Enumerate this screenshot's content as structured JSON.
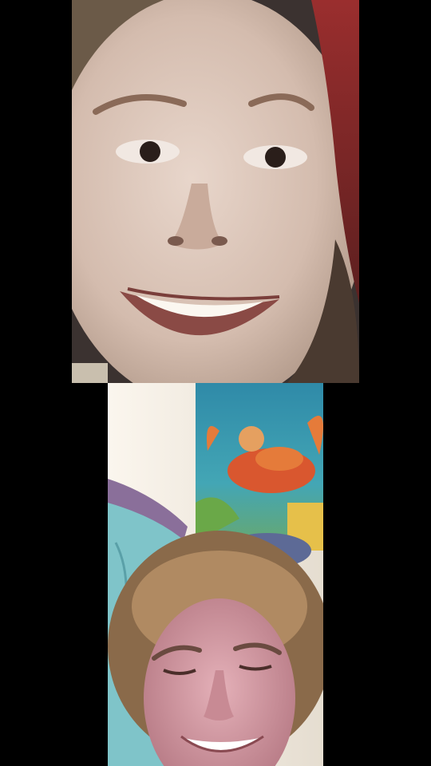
{
  "call": {
    "participants": [
      {
        "role": "remote-participant-video"
      },
      {
        "role": "self-preview-video"
      }
    ]
  },
  "colors": {
    "background": "#000000",
    "top_skin": "#d9c3b6",
    "top_hair": "#6b5a48",
    "top_red_fabric": "#8a2a2a",
    "bottom_wall": "#f2ede4",
    "bottom_blanket": "#7fc4c9",
    "bottom_hair": "#8a6a4a",
    "bottom_skin": "#d79aa8"
  }
}
